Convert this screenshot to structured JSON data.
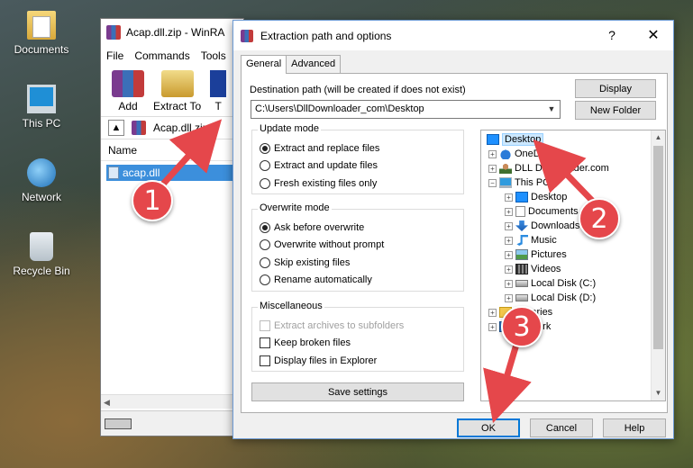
{
  "desktop": {
    "icons": [
      {
        "label": "Documents"
      },
      {
        "label": "This PC"
      },
      {
        "label": "Network"
      },
      {
        "label": "Recycle Bin"
      }
    ]
  },
  "winrar": {
    "title": "Acap.dll.zip - WinRA",
    "menu": [
      "File",
      "Commands",
      "Tools"
    ],
    "toolbar": {
      "add": "Add",
      "extract_to": "Extract To",
      "test": "T"
    },
    "path": "Acap.dll.zip",
    "column_name": "Name",
    "selected_file": "acap.dll"
  },
  "dialog": {
    "title": "Extraction path and options",
    "help": "?",
    "close": "✕",
    "tabs": {
      "general": "General",
      "advanced": "Advanced"
    },
    "dest_label": "Destination path (will be created if does not exist)",
    "dest_value": "C:\\Users\\DllDownloader_com\\Desktop",
    "display_btn": "Display",
    "new_folder_btn": "New Folder",
    "update_mode": {
      "title": "Update mode",
      "options": [
        "Extract and replace files",
        "Extract and update files",
        "Fresh existing files only"
      ],
      "selected": 0
    },
    "overwrite_mode": {
      "title": "Overwrite mode",
      "options": [
        "Ask before overwrite",
        "Overwrite without prompt",
        "Skip existing files",
        "Rename automatically"
      ],
      "selected": 0
    },
    "misc": {
      "title": "Miscellaneous",
      "options": [
        "Extract archives to subfolders",
        "Keep broken files",
        "Display files in Explorer"
      ]
    },
    "save_settings": "Save settings",
    "tree": [
      "Desktop",
      "OneDrive",
      "DLL Downloader.com",
      "This PC",
      "Desktop",
      "Documents",
      "Downloads",
      "Music",
      "Pictures",
      "Videos",
      "Local Disk (C:)",
      "Local Disk (D:)",
      "Libraries",
      "Network"
    ],
    "ok": "OK",
    "cancel": "Cancel",
    "helpbtn": "Help"
  },
  "callouts": [
    "1",
    "2",
    "3"
  ],
  "colors": {
    "callout": "#e5474b",
    "selection": "#3c8fdc",
    "tree_selection": "#cce8ff"
  }
}
